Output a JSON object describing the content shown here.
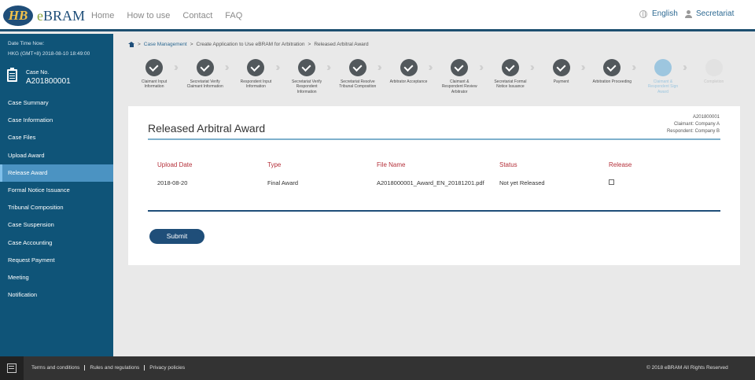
{
  "header": {
    "logo_mark": "HB",
    "logo_e": "e",
    "logo_rest": "BRAM",
    "nav": [
      "Home",
      "How to use",
      "Contact",
      "FAQ"
    ],
    "language": "English",
    "user": "Secretariat"
  },
  "sidebar": {
    "datetime_label": "Date Time Now:",
    "datetime_value": "HKG (GMT+8) 2018-08-10 18:49:00",
    "case_label": "Case No.",
    "case_no": "A201800001",
    "items": [
      "Case Summary",
      "Case Information",
      "Case Files",
      "Upload Award",
      "Release Award",
      "Formal Notice Issuance",
      "Tribunal Composition",
      "Case Suspension",
      "Case Accounting",
      "Request Payment",
      "Meeting",
      "Notification"
    ],
    "active_index": 4
  },
  "breadcrumb": {
    "sep": ">",
    "items": [
      "Case Management",
      "Create Application to Use eBRAM for Arbitration",
      "Released Arbitral Award"
    ]
  },
  "steps": [
    {
      "label": "Claimant Input Information",
      "state": "done"
    },
    {
      "label": "Secretariat Verify Claimant Information",
      "state": "done"
    },
    {
      "label": "Respondent Input Information",
      "state": "done"
    },
    {
      "label": "Secretariat Verify Respondent Information",
      "state": "done"
    },
    {
      "label": "Secretariat Resolve Tribunal Composition",
      "state": "done"
    },
    {
      "label": "Arbitrator Acceptance",
      "state": "done"
    },
    {
      "label": "Claimant & Respondent Review Arbitrator",
      "state": "done"
    },
    {
      "label": "Secretariat Formal Notice Issuance",
      "state": "done"
    },
    {
      "label": "Payment",
      "state": "done"
    },
    {
      "label": "Arbitration Proceeding",
      "state": "done"
    },
    {
      "label": "Claimant & Respondent Sign Award",
      "state": "current"
    },
    {
      "label": "Completion",
      "state": "todo"
    }
  ],
  "card": {
    "title": "Released Arbitral Award",
    "case_no": "A201800001",
    "claimant": "Claimant: Company A",
    "respondent": "Respondent: Company B",
    "columns": [
      "Upload Date",
      "Type",
      "File Name",
      "Status",
      "Release"
    ],
    "row": {
      "upload_date": "2018-08-20",
      "type": "Final Award",
      "file_name": "A2018000001_Award_EN_20181201.pdf",
      "status": "Not yet Released",
      "release_checked": false
    },
    "submit_label": "Submit"
  },
  "footer": {
    "links": [
      "Terms and conditions",
      "Rules and regulations",
      "Privacy policies"
    ],
    "copyright": "© 2018 eBRAM All Rights Reserved"
  },
  "colors": {
    "brand": "#1f4e79",
    "sidebar": "#0f5478",
    "sidebar_active": "#4b93c2",
    "header_red": "#b5303a"
  }
}
